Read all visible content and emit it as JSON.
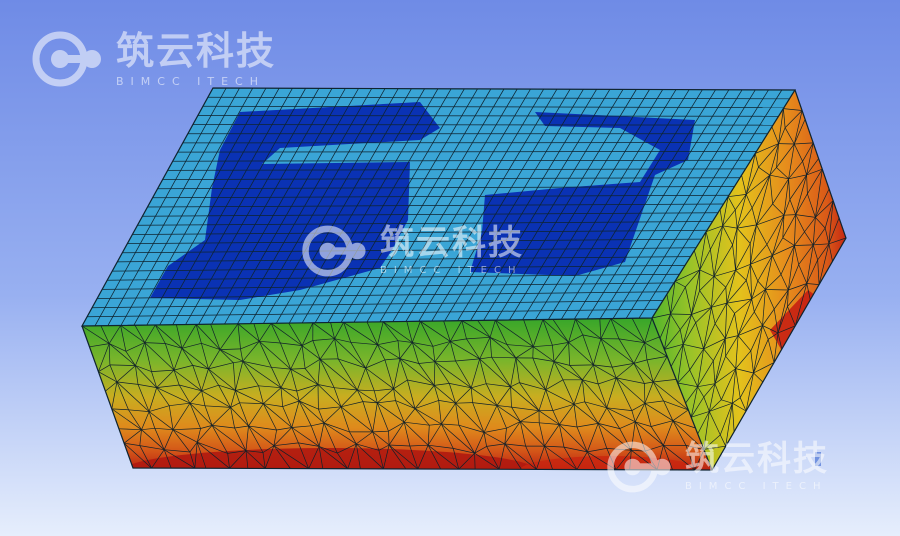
{
  "watermark": {
    "brand_cn": "筑云科技",
    "brand_en": "BIMCC ITECH",
    "logo_icon": "bimcc-logo-icon"
  },
  "colors": {
    "background_top": "#6f8be6",
    "background_bottom": "#e6eefc",
    "top_face": "#3aa5d6",
    "low_region": "#0a32b4",
    "contour_red": "#c41a12",
    "contour_orange": "#e07a1a",
    "contour_yellow": "#d6c21c",
    "contour_green": "#3aa528",
    "mesh_line": "#10202a"
  }
}
